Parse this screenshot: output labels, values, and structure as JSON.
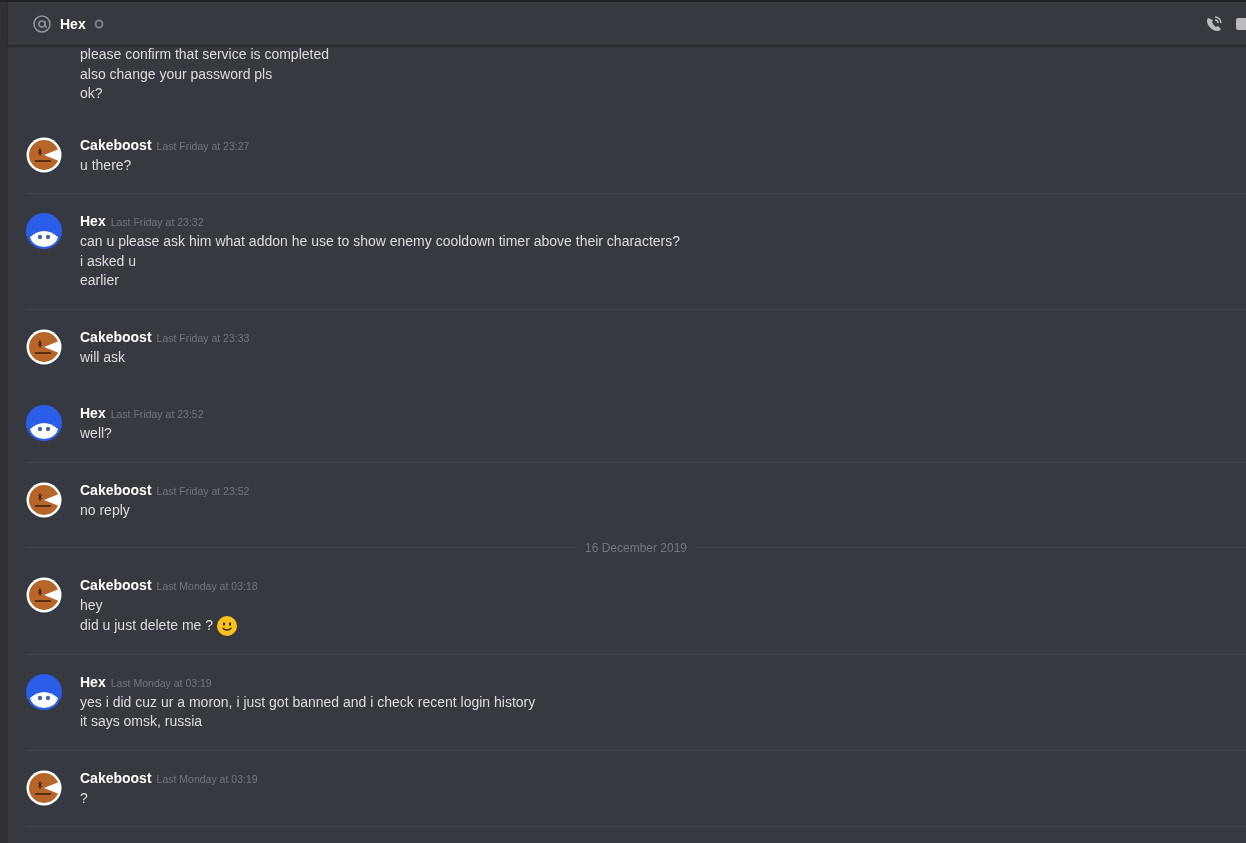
{
  "header": {
    "title": "Hex",
    "online": false
  },
  "items": [
    {
      "kind": "continuation",
      "lines": [
        "please confirm that service is completed",
        "also change your password pls",
        "ok?"
      ]
    },
    {
      "kind": "group",
      "avatar": {
        "kind": "cake"
      },
      "author": "Cakeboost",
      "time": "Last Friday at 23:27",
      "lines": [
        "u there?"
      ],
      "smiley": false,
      "separator_below": true
    },
    {
      "kind": "group",
      "avatar": {
        "kind": "hex"
      },
      "author": "Hex",
      "time": "Last Friday at 23:32",
      "lines": [
        "can u please ask him what addon he use to show enemy cooldown timer above their characters?",
        "i asked u",
        "earlier"
      ],
      "smiley": false,
      "separator_below": true
    },
    {
      "kind": "group",
      "avatar": {
        "kind": "cake"
      },
      "author": "Cakeboost",
      "time": "Last Friday at 23:33",
      "lines": [
        "will ask"
      ],
      "smiley": false,
      "separator_below": false
    },
    {
      "kind": "group",
      "avatar": {
        "kind": "hex"
      },
      "author": "Hex",
      "time": "Last Friday at 23:52",
      "lines": [
        "well?"
      ],
      "smiley": false,
      "separator_below": true
    },
    {
      "kind": "group",
      "avatar": {
        "kind": "cake"
      },
      "author": "Cakeboost",
      "time": "Last Friday at 23:52",
      "lines": [
        "no reply"
      ],
      "smiley": false,
      "separator_below": false
    },
    {
      "kind": "date",
      "label": "16 December 2019"
    },
    {
      "kind": "group",
      "avatar": {
        "kind": "cake"
      },
      "author": "Cakeboost",
      "time": "Last Monday at 03:18",
      "lines": [
        "hey",
        "did u just delete me ?"
      ],
      "smiley": true,
      "separator_below": true
    },
    {
      "kind": "group",
      "avatar": {
        "kind": "hex"
      },
      "author": "Hex",
      "time": "Last Monday at 03:19",
      "lines": [
        "yes i did cuz ur a moron, i just got banned and i check recent login history",
        "it says omsk, russia"
      ],
      "smiley": false,
      "separator_below": true
    },
    {
      "kind": "group",
      "avatar": {
        "kind": "cake"
      },
      "author": "Cakeboost",
      "time": "Last Monday at 03:19",
      "lines": [
        "?"
      ],
      "smiley": false,
      "separator_below": true
    }
  ]
}
